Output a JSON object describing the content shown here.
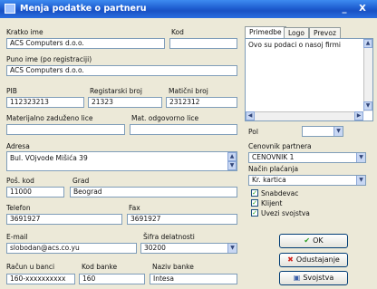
{
  "window": {
    "title": "Menja podatke o partneru",
    "minimize": "_",
    "close": "X"
  },
  "form": {
    "kratko_ime": {
      "label": "Kratko ime",
      "value": "ACS Computers d.o.o."
    },
    "kod": {
      "label": "Kod",
      "value": ""
    },
    "puno_ime": {
      "label": "Puno ime (po registraciji)",
      "value": "ACS Computers d.o.o."
    },
    "pib": {
      "label": "PIB",
      "value": "112323213"
    },
    "registarski_broj": {
      "label": "Registarski broj",
      "value": "21323"
    },
    "maticni_broj": {
      "label": "Matični broj",
      "value": "2312312"
    },
    "materijalno_lice": {
      "label": "Materijalno zaduženo lice",
      "value": ""
    },
    "mat_odgovorno_lice": {
      "label": "Mat. odgovorno lice",
      "value": ""
    },
    "adresa": {
      "label": "Adresa",
      "value": "Bul. VOjvode Mišića 39"
    },
    "post_kod": {
      "label": "Poš. kod",
      "value": "11000"
    },
    "grad": {
      "label": "Grad",
      "value": "Beograd"
    },
    "telefon": {
      "label": "Telefon",
      "value": "3691927"
    },
    "fax": {
      "label": "Fax",
      "value": "3691927"
    },
    "email": {
      "label": "E-mail",
      "value": "slobodan@acs.co.yu"
    },
    "sifra_delatnosti": {
      "label": "Šifra delatnosti",
      "value": "30200"
    },
    "racun": {
      "label": "Račun u banci",
      "value": "160-xxxxxxxxxx"
    },
    "kod_banke": {
      "label": "Kod banke",
      "value": "160"
    },
    "naziv_banke": {
      "label": "Naziv banke",
      "value": "Intesa"
    }
  },
  "tabs": [
    {
      "label": "Primedbe"
    },
    {
      "label": "Logo"
    },
    {
      "label": "Prevoz"
    }
  ],
  "notes": {
    "text": "Ovo su podaci o nasoj firmi"
  },
  "right": {
    "pol_label": "Pol",
    "pol_value": "",
    "cenovnik_label": "Cenovnik partnera",
    "cenovnik_value": "CENOVNIK 1",
    "nacin_label": "Način plaćanja",
    "nacin_value": "Kr. kartica",
    "checks": [
      {
        "label": "Snabdevac",
        "checked": true
      },
      {
        "label": "Klijent",
        "checked": true
      },
      {
        "label": "Uvezi svojstva",
        "checked": true
      }
    ],
    "ok_label": "OK",
    "cancel_label": "Odustajanje",
    "props_label": "Svojstva",
    "check_mark": "✓"
  }
}
